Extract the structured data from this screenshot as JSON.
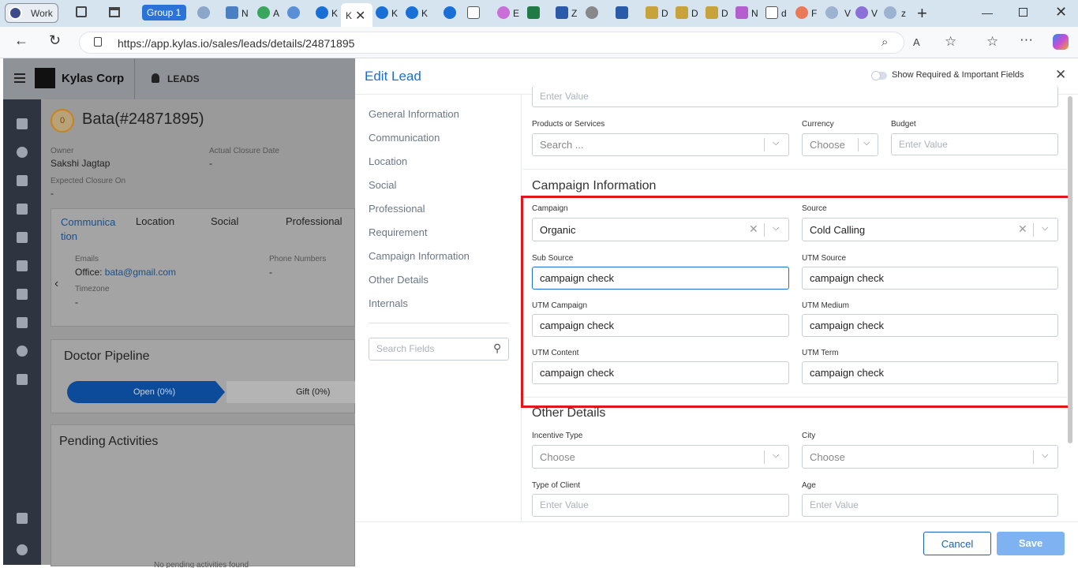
{
  "browser": {
    "profile": "Work",
    "group_label": "Group 1",
    "url": "https://app.kylas.io/sales/leads/details/24871895",
    "tabs": [
      "N",
      "A",
      "K",
      "K",
      "K",
      "K",
      "E",
      "Z",
      "D",
      "D",
      "D",
      "N",
      "d",
      "F",
      "V",
      "V",
      "z"
    ]
  },
  "app": {
    "company": "Kylas Corp",
    "module": "LEADS",
    "lead_title": "Bata(#24871895)",
    "lead_badge": "0",
    "owner_label": "Owner",
    "owner_value": "Sakshi Jagtap",
    "closure_label": "Actual Closure Date",
    "closure_value": "-",
    "expected_label": "Expected Closure On",
    "expected_value": "-",
    "tabs": [
      "Communica tion",
      "Location",
      "Social",
      "Professional"
    ],
    "emails_label": "Emails",
    "emails_prefix": "Office: ",
    "emails_value": "bata@gmail.com",
    "phones_label": "Phone Numbers",
    "phones_value": "-",
    "timezone_label": "Timezone",
    "timezone_value": "-",
    "pipeline_title": "Doctor Pipeline",
    "pipeline_open": "Open (0%)",
    "pipeline_gift": "Gift (0%)",
    "pending_title": "Pending Activities",
    "pending_empty": "No pending activities found"
  },
  "modal": {
    "title": "Edit Lead",
    "toggle_label": "Show Required & Important Fields",
    "nav": [
      "General Information",
      "Communication",
      "Location",
      "Social",
      "Professional",
      "Requirement",
      "Campaign Information",
      "Other Details",
      "Internals"
    ],
    "search_placeholder": "Search Fields",
    "top_placeholder": "Enter Value",
    "products_label": "Products or Services",
    "products_placeholder": "Search ...",
    "currency_label": "Currency",
    "currency_value": "Choose",
    "budget_label": "Budget",
    "budget_placeholder": "Enter Value",
    "campaign_section": "Campaign Information",
    "campaign_label": "Campaign",
    "campaign_value": "Organic",
    "source_label": "Source",
    "source_value": "Cold Calling",
    "subsource_label": "Sub Source",
    "subsource_value": "campaign check",
    "utm_source_label": "UTM Source",
    "utm_source_value": "campaign check",
    "utm_campaign_label": "UTM Campaign",
    "utm_campaign_value": "campaign check",
    "utm_medium_label": "UTM Medium",
    "utm_medium_value": "campaign check",
    "utm_content_label": "UTM Content",
    "utm_content_value": "campaign check",
    "utm_term_label": "UTM Term",
    "utm_term_value": "campaign check",
    "other_section": "Other Details",
    "incentive_label": "Incentive Type",
    "incentive_value": "Choose",
    "city_label": "City",
    "city_value": "Choose",
    "client_label": "Type of Client",
    "client_placeholder": "Enter Value",
    "age_label": "Age",
    "age_placeholder": "Enter Value",
    "cancel": "Cancel",
    "save": "Save"
  },
  "colors": {
    "accent": "#1a6fd6",
    "highlight": "#e0161a",
    "save_bg": "#7fb2f0"
  }
}
